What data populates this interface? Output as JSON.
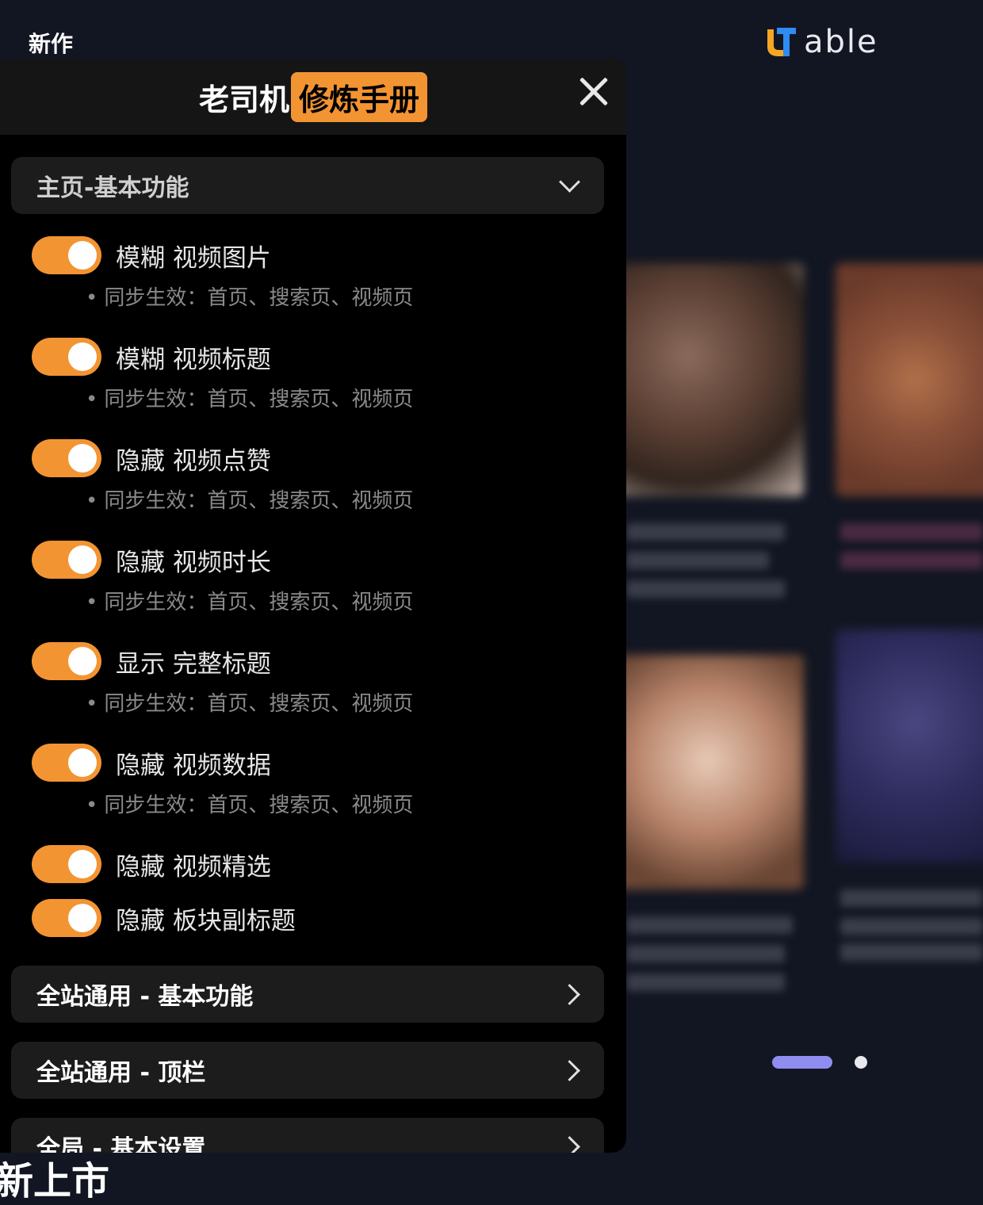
{
  "background": {
    "top_label": "新作",
    "logo_text": "able",
    "bottom_label": "新上市"
  },
  "panel": {
    "title_plain": "老司机",
    "title_badge": "修炼手册",
    "sections": [
      {
        "label": "主页-基本功能",
        "expanded": true
      },
      {
        "label": "全站通用 - 基本功能",
        "expanded": false
      },
      {
        "label": "全站通用 - 顶栏",
        "expanded": false
      },
      {
        "label": "全局 - 基本设置",
        "expanded": false
      }
    ],
    "items": [
      {
        "label": "模糊 视频图片",
        "sub": "同步生效：首页、搜索页、视频页",
        "on": true
      },
      {
        "label": "模糊 视频标题",
        "sub": "同步生效：首页、搜索页、视频页",
        "on": true
      },
      {
        "label": "隐藏 视频点赞",
        "sub": "同步生效：首页、搜索页、视频页",
        "on": true
      },
      {
        "label": "隐藏 视频时长",
        "sub": "同步生效：首页、搜索页、视频页",
        "on": true
      },
      {
        "label": "显示 完整标题",
        "sub": "同步生效：首页、搜索页、视频页",
        "on": true
      },
      {
        "label": "隐藏 视频数据",
        "sub": "同步生效：首页、搜索页、视频页",
        "on": true
      },
      {
        "label": "隐藏 视频精选",
        "sub": "",
        "on": true
      },
      {
        "label": "隐藏 板块副标题",
        "sub": "",
        "on": true
      }
    ]
  },
  "colors": {
    "accent": "#f39433",
    "panel_bg": "#000000",
    "page_bg": "#121622",
    "pager_active": "#8f8ef0"
  },
  "icons": {
    "close": "close-icon",
    "expand": "chevron-down-icon",
    "collapsed": "chevron-right-icon"
  }
}
